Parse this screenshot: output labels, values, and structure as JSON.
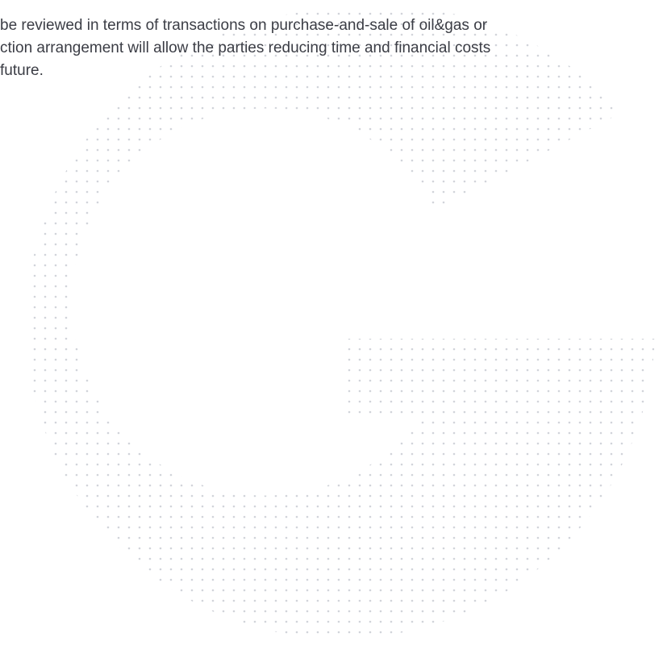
{
  "body": {
    "lines": [
      "be reviewed in terms of transactions on purchase-and-sale of oil&gas or",
      "ction arrangement will allow the parties reducing time and financial costs",
      "future."
    ]
  },
  "colors": {
    "text": "#3b3d45",
    "dots": "#c9ccd3",
    "background": "#ffffff"
  }
}
